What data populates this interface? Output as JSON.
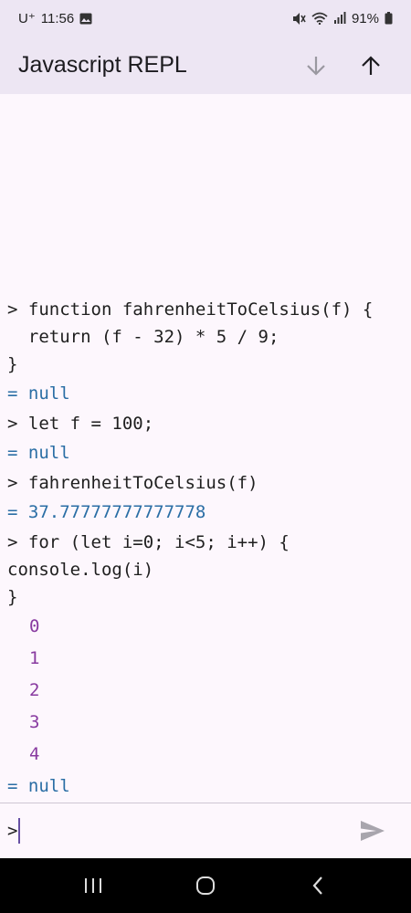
{
  "status_bar": {
    "carrier": "U⁺",
    "time": "11:56",
    "battery": "91%",
    "icons": [
      "gallery-icon",
      "mute-icon",
      "wifi-icon",
      "signal-icon",
      "battery-icon"
    ]
  },
  "app_bar": {
    "title": "Javascript REPL",
    "actions": [
      "scroll-down-icon",
      "scroll-up-icon"
    ]
  },
  "console": {
    "entries": [
      {
        "kind": "input",
        "text": "> function fahrenheitToCelsius(f) {"
      },
      {
        "kind": "input",
        "text": "  return (f - 32) * 5 / 9;"
      },
      {
        "kind": "input",
        "text": "}"
      },
      {
        "kind": "result",
        "text": "= null"
      },
      {
        "kind": "input",
        "text": "> let f = 100;"
      },
      {
        "kind": "result",
        "text": "= null"
      },
      {
        "kind": "input",
        "text": "> fahrenheitToCelsius(f)"
      },
      {
        "kind": "result",
        "text": "= 37.77777777777778"
      },
      {
        "kind": "input",
        "text": "> for (let i=0; i<5; i++) {"
      },
      {
        "kind": "input",
        "text": "console.log(i)"
      },
      {
        "kind": "input",
        "text": "}"
      },
      {
        "kind": "log",
        "text": "0"
      },
      {
        "kind": "log",
        "text": "1"
      },
      {
        "kind": "log",
        "text": "2"
      },
      {
        "kind": "log",
        "text": "3"
      },
      {
        "kind": "log",
        "text": "4"
      },
      {
        "kind": "result",
        "text": "= null"
      }
    ]
  },
  "input": {
    "prompt": ">",
    "value": ""
  },
  "colors": {
    "surface": "#fdf7fd",
    "app_bar": "#ede6f3",
    "input_text": "#1f1f1f",
    "result_text": "#2a6ea5",
    "log_text": "#883aa0",
    "caret": "#6750a4"
  },
  "nav": [
    "recents-icon",
    "home-icon",
    "back-icon"
  ]
}
